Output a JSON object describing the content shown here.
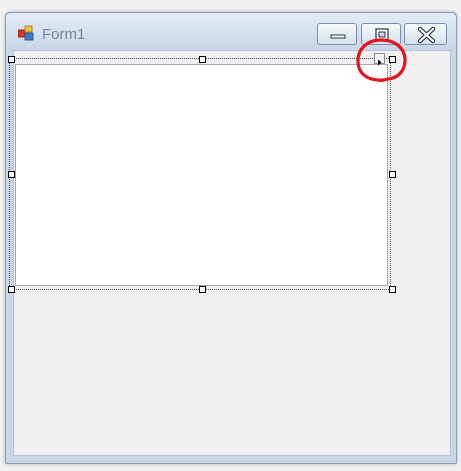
{
  "window": {
    "title": "Form1",
    "icon": "winforms-app-icon",
    "buttons": {
      "minimize_icon": "minimize-icon",
      "maximize_icon": "maximize-icon",
      "close_icon": "close-icon"
    }
  },
  "designer": {
    "selected_control_icon": "panel-control",
    "smart_tag_icon": "smart-tag-arrow-icon",
    "annotation_icon": "red-circle-annotation",
    "annotation_color": "#e3141e"
  },
  "colors": {
    "title_bar": "#c8d7e8",
    "client_area": "#f0f0f0",
    "title_text": "#7a8592"
  }
}
